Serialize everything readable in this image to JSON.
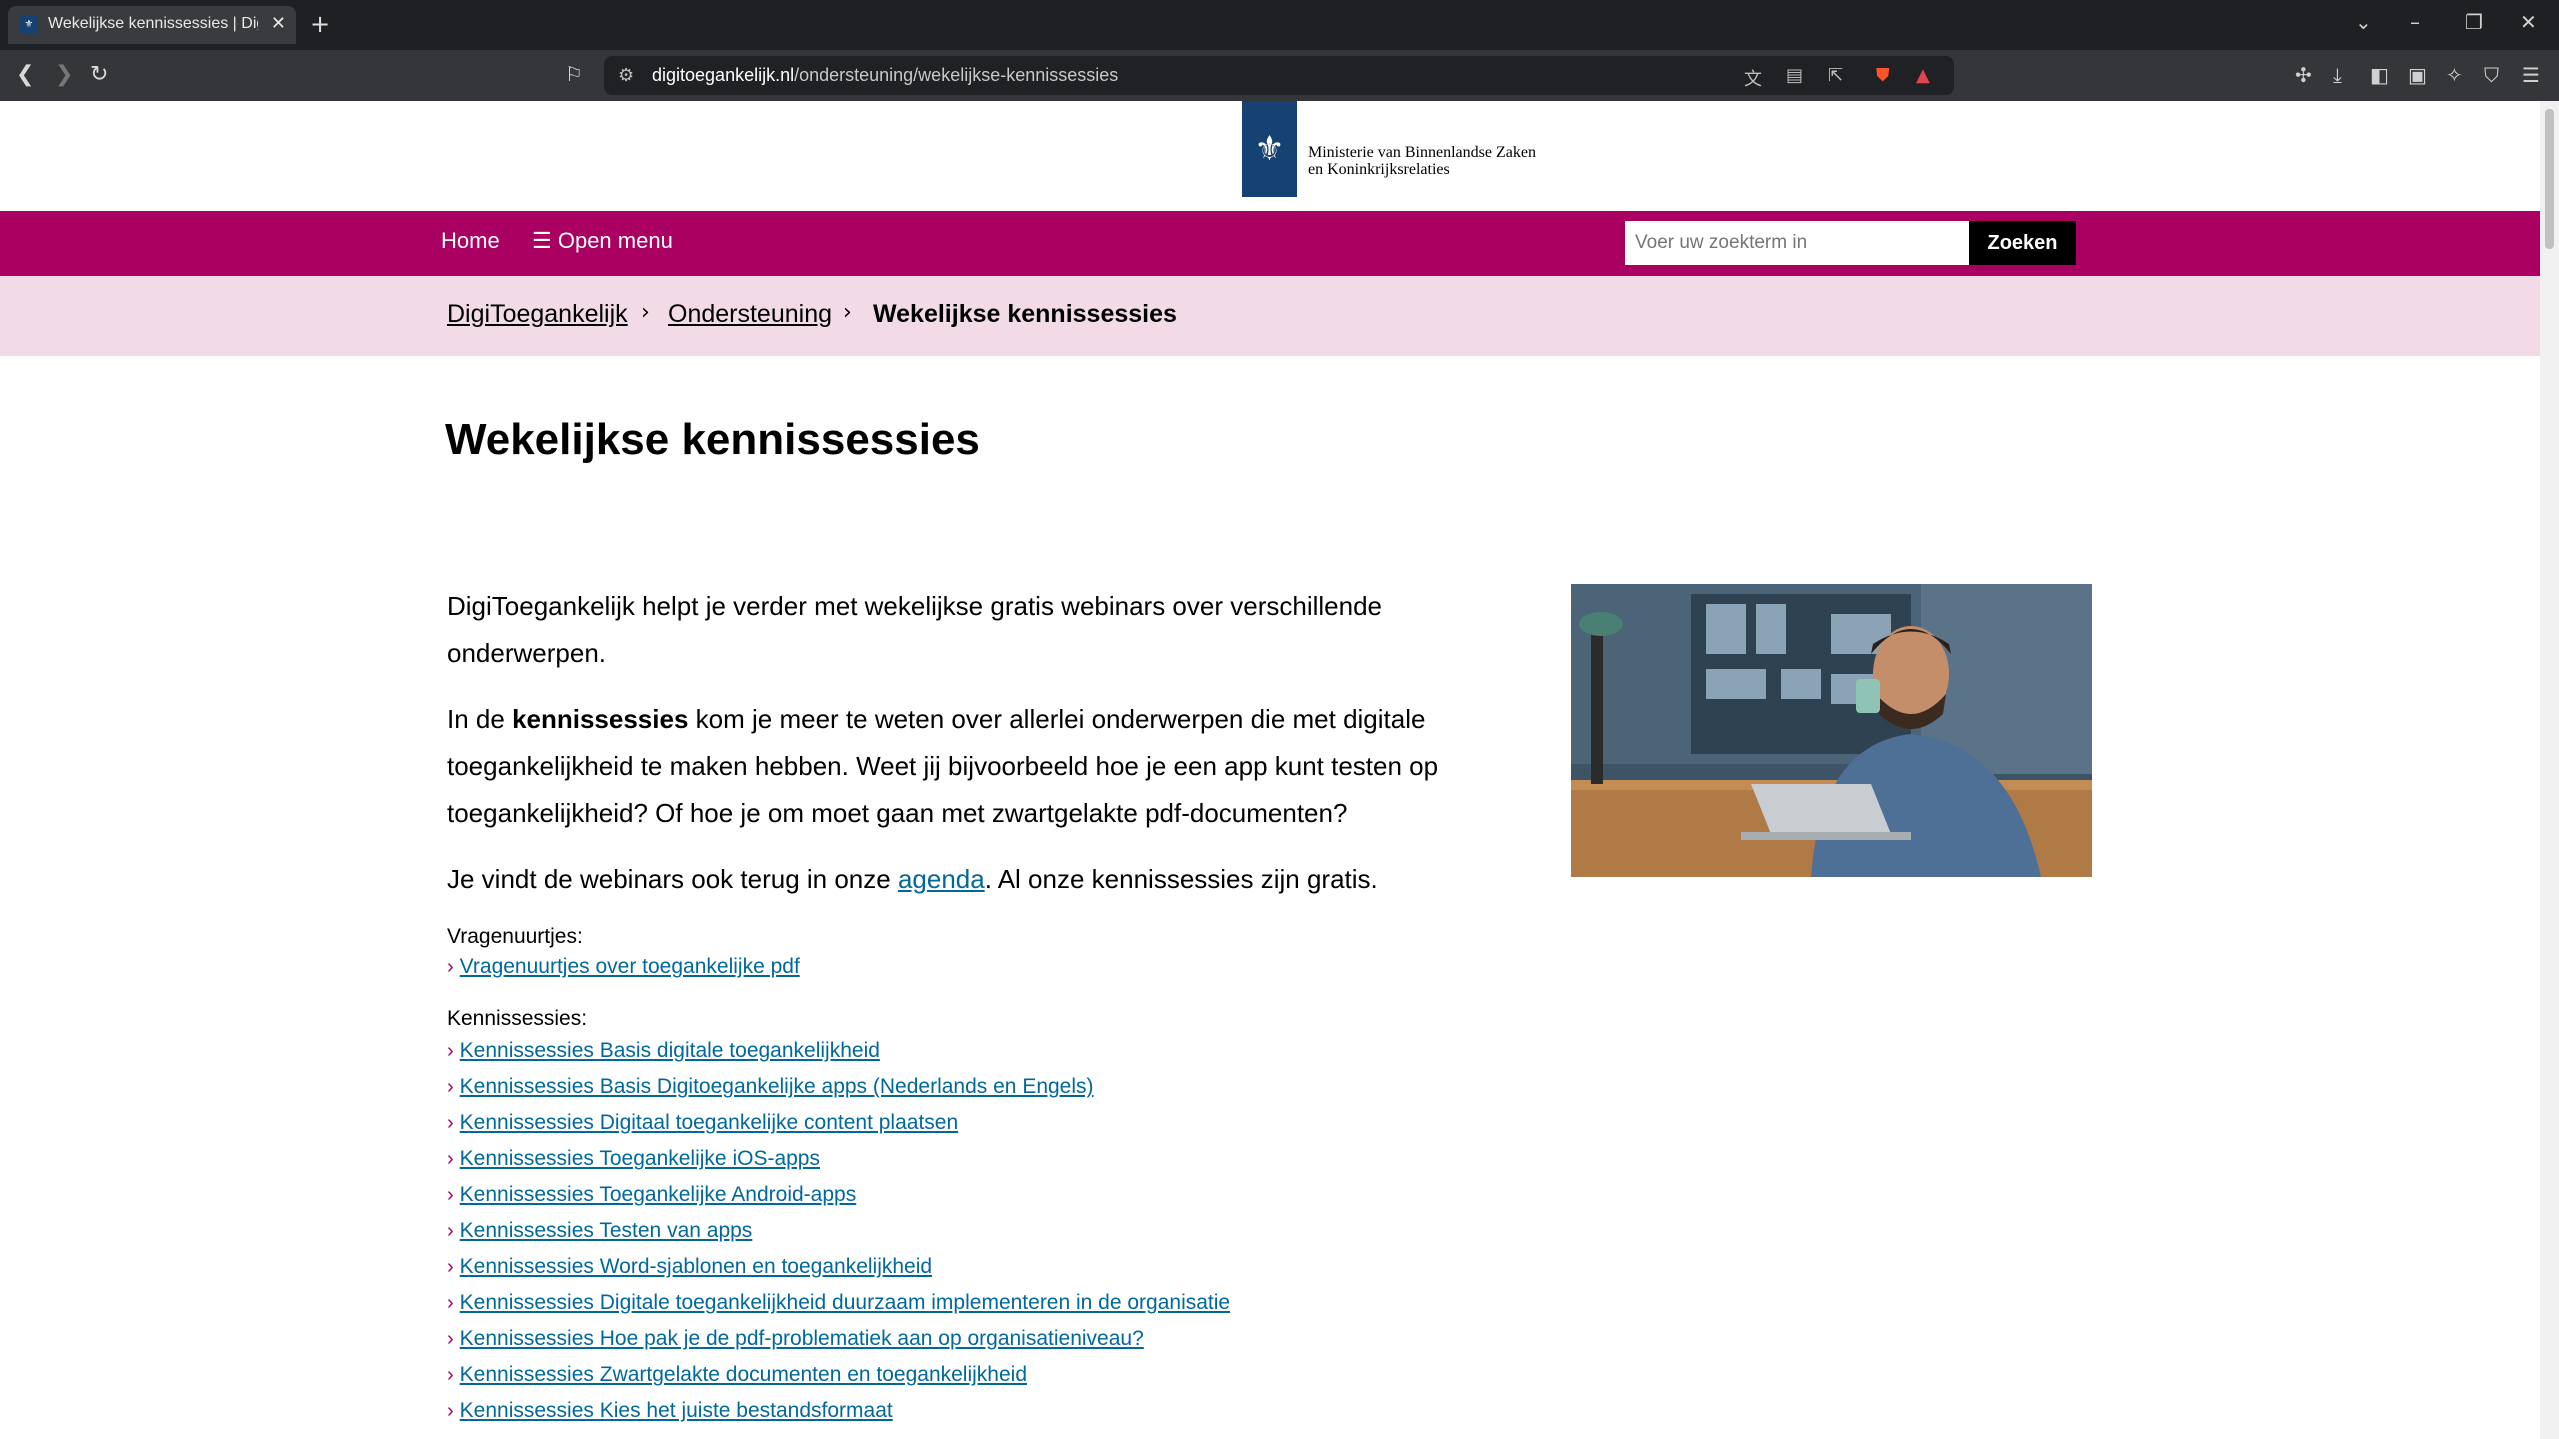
{
  "browser": {
    "tab_title": "Wekelijkse kennissessies | DigiToegankelijk",
    "url_domain": "digitoegankelijk.nl",
    "url_path": "/ondersteuning/wekelijkse-kennissessies"
  },
  "header": {
    "org_line1": "Ministerie van Binnenlandse Zaken",
    "org_line2": "en Koninkrijksrelaties"
  },
  "nav": {
    "home": "Home",
    "menu": "Open menu",
    "search_placeholder": "Voer uw zoekterm in",
    "search_button": "Zoeken"
  },
  "breadcrumb": {
    "items": [
      "DigiToegankelijk",
      "Ondersteuning",
      "Wekelijkse kennissessies"
    ]
  },
  "main": {
    "title": "Wekelijkse kennissessies",
    "intro": "DigiToegankelijk helpt je verder met wekelijkse gratis webinars over verschillende onderwerpen.",
    "p2_before": "In de ",
    "p2_bold": "kennissessies",
    "p2_after": " kom je meer te weten over allerlei onderwerpen die met digitale toegankelijkheid te maken hebben. Weet jij bijvoorbeeld hoe je een app kunt testen op toegankelijkheid? Of hoe je om moet gaan met zwartgelakte pdf-documenten?",
    "p3_before": "Je vindt de webinars ook terug in onze ",
    "p3_link": "agenda",
    "p3_after": ". Al onze kennissessies zijn gratis.",
    "vragen_label": "Vragenuurtjes:",
    "vragen_links": [
      "Vragenuurtjes over toegankelijke pdf"
    ],
    "kennis_label": "Kennissessies:",
    "kennis_links": [
      "Kennissessies Basis digitale toegankelijkheid",
      "Kennissessies Basis Digitoegankelijke apps (Nederlands en Engels)",
      "Kennissessies Digitaal toegankelijke content plaatsen",
      "Kennissessies Toegankelijke iOS-apps",
      "Kennissessies Toegankelijke Android-apps",
      "Kennissessies Testen van apps",
      "Kennissessies Word-sjablonen en toegankelijkheid",
      "Kennissessies Digitale toegankelijkheid duurzaam implementeren in de organisatie",
      "Kennissessies Hoe pak je de pdf-problematiek aan op organisatieniveau?",
      "Kennissessies Zwartgelakte documenten en toegankelijkheid",
      "Kennissessies Kies het juiste bestandsformaat"
    ]
  }
}
